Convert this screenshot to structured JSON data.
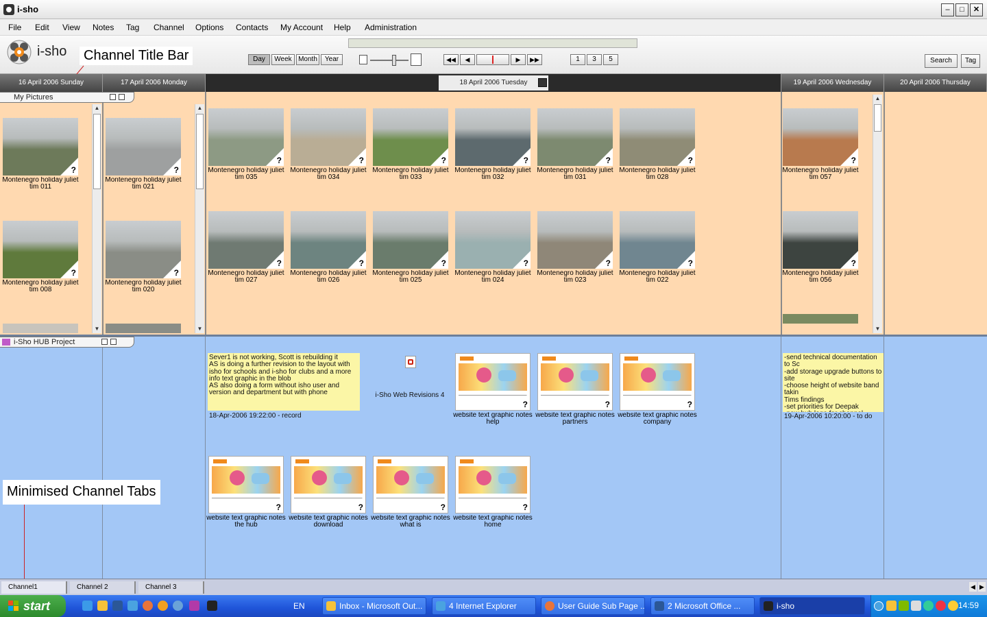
{
  "window": {
    "title": "i-sho"
  },
  "menu": [
    "File",
    "Edit",
    "View",
    "Notes",
    "Tag",
    "Channel",
    "Options",
    "Contacts",
    "My Account",
    "Help",
    "Administration"
  ],
  "toolbar": {
    "brand": "i-sho",
    "views": [
      "Day",
      "Week",
      "Month",
      "Year"
    ],
    "active_view": "Day",
    "layout_buttons": [
      "1",
      "3",
      "5"
    ],
    "search": "Search",
    "tag": "Tag"
  },
  "callouts": {
    "title_bar": "Channel Title Bar",
    "tabs": "Minimised Channel Tabs"
  },
  "dates": [
    "16 April 2006 Sunday",
    "17 April 2006 Monday",
    "18 April 2006 Tuesday",
    "19 April 2006 Wednesday",
    "20 April 2006 Thursday"
  ],
  "channel1": {
    "name": "My Pictures",
    "col16": [
      {
        "caption": "Montenegro holiday juliet tim 011",
        "color": "#6d7a5a"
      },
      {
        "caption": "Montenegro holiday juliet tim 008",
        "color": "#5f7a3c"
      }
    ],
    "col17": [
      {
        "caption": "Montenegro holiday juliet tim 021",
        "color": "#9ea0a0"
      },
      {
        "caption": "Montenegro holiday juliet tim 020",
        "color": "#8a8d86"
      }
    ],
    "col18": [
      {
        "caption": "Montenegro holiday juliet tim 035",
        "color": "#8d9a84"
      },
      {
        "caption": "Montenegro holiday juliet tim 034",
        "color": "#b9ad95"
      },
      {
        "caption": "Montenegro holiday juliet tim 033",
        "color": "#6e8e4c"
      },
      {
        "caption": "Montenegro holiday juliet tim 032",
        "color": "#5d6a6e"
      },
      {
        "caption": "Montenegro holiday juliet tim 031",
        "color": "#7d8a70"
      },
      {
        "caption": "Montenegro holiday juliet tim 028",
        "color": "#8f8c76"
      },
      {
        "caption": "Montenegro holiday juliet tim 027",
        "color": "#6f7a72"
      },
      {
        "caption": "Montenegro holiday juliet tim 026",
        "color": "#6d8480"
      },
      {
        "caption": "Montenegro holiday juliet tim 025",
        "color": "#6a7c6c"
      },
      {
        "caption": "Montenegro holiday juliet tim 024",
        "color": "#9ab0b0"
      },
      {
        "caption": "Montenegro holiday juliet tim 023",
        "color": "#8f8778"
      },
      {
        "caption": "Montenegro holiday juliet tim 022",
        "color": "#708690"
      }
    ],
    "col19": [
      {
        "caption": "Montenegro holiday juliet tim 057",
        "color": "#b87a4e"
      },
      {
        "caption": "Montenegro holiday juliet tim 056",
        "color": "#3d4440"
      }
    ]
  },
  "channel2": {
    "name": "i-Sho HUB Project",
    "note1": {
      "text": "Sever1 is not working, Scott is rebuilding it\nAS is doing a further revision to the layout with isho for schools and i-sho for clubs and a more info text graphic in the blob\nAS also doing a form without isho user and version and department but with phone",
      "meta": "18-Apr-2006 19:22:00 - record"
    },
    "doc": {
      "caption": "i-Sho Web Revisions 4"
    },
    "row1": [
      {
        "caption": "website text graphic notes help"
      },
      {
        "caption": "website text graphic notes partners"
      },
      {
        "caption": "website text graphic notes company"
      }
    ],
    "row2": [
      {
        "caption": "website text graphic notes the hub"
      },
      {
        "caption": "website text graphic notes download"
      },
      {
        "caption": "website text graphic notes what is"
      },
      {
        "caption": "website text graphic notes home"
      }
    ],
    "note2": {
      "text": "-send technical documentation to Sc\n-add storage upgrade buttons to site\n-choose height of website band takin\nTims findings\n-set priorities for Deepak\n-new hub logo for channel headers\n-admin process for storage upgrade\n-payment system for website to bu",
      "meta": "19-Apr-2006 10:20:00 - to do"
    }
  },
  "bottom_tabs": [
    "Channel1",
    "Channel 2",
    "Channel 3"
  ],
  "taskbar": {
    "start": "start",
    "lang": "EN",
    "items": [
      "Inbox - Microsoft Out...",
      "4 Internet Explorer",
      "User Guide Sub Page ...",
      "2 Microsoft Office ...",
      "i-sho"
    ],
    "clock": "14:59"
  }
}
